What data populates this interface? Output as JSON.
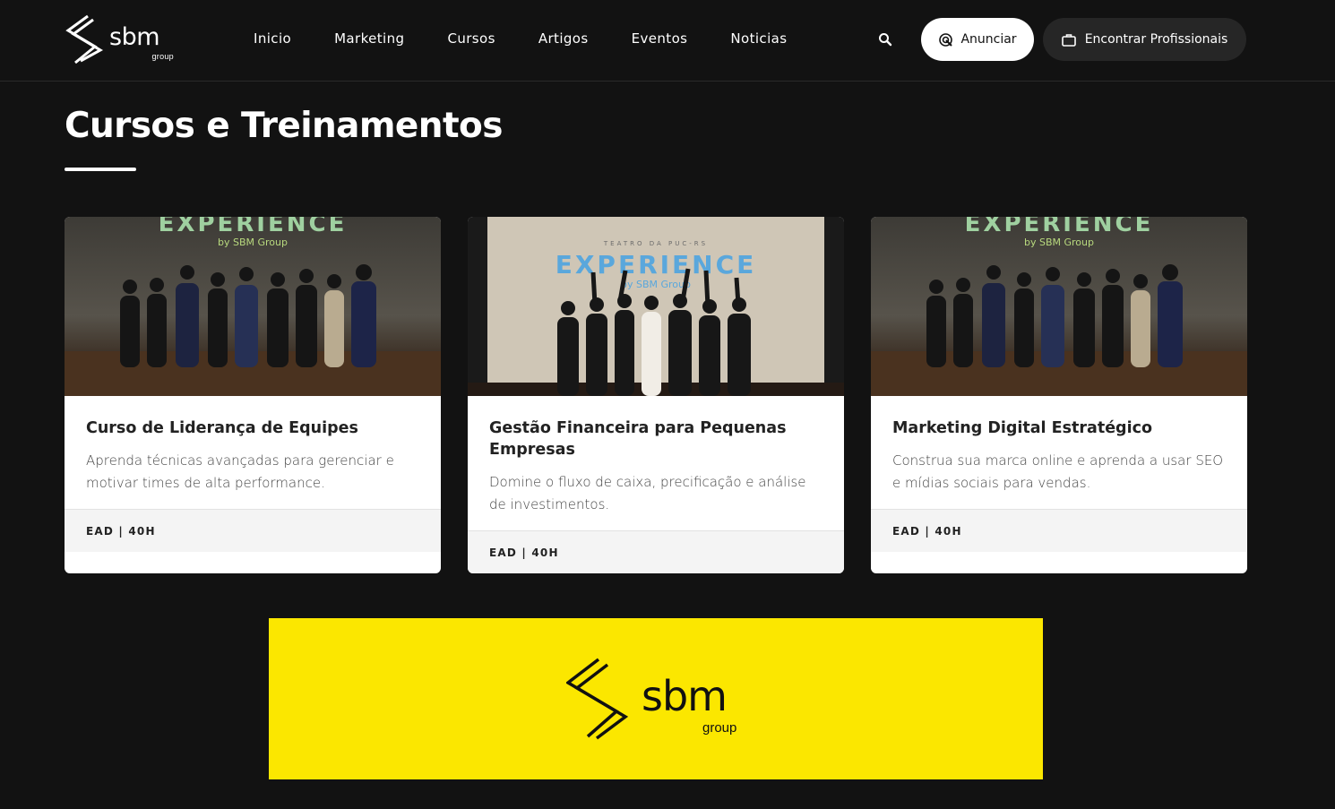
{
  "header": {
    "logo_word": "sbm",
    "logo_sub": "group",
    "nav": [
      "Inicio",
      "Marketing",
      "Cursos",
      "Artigos",
      "Eventos",
      "Noticias"
    ],
    "search_icon": "search-icon",
    "anunciar_label": "Anunciar",
    "encontrar_label": "Encontrar Profissionais"
  },
  "page": {
    "title": "Cursos e Treinamentos"
  },
  "cards": [
    {
      "image_text_main": "EXPERIENCE",
      "image_text_sub": "by SBM Group",
      "title": "Curso de Liderança de Equipes",
      "description": "Aprenda técnicas avançadas para gerenciar e motivar times de alta performance.",
      "meta": "EAD | 40H"
    },
    {
      "image_text_top": "TEATRO DA PUC-RS",
      "image_text_main": "EXPERIENCE",
      "image_text_sub": "by SBM Group",
      "title": "Gestão Financeira para Pequenas Empresas",
      "description": "Domine o fluxo de caixa, precificação e análise de investimentos.",
      "meta": "EAD | 40H"
    },
    {
      "image_text_main": "EXPERIENCE",
      "image_text_sub": "by SBM Group",
      "title": "Marketing Digital Estratégico",
      "description": "Construa sua marca online e aprenda a usar SEO e mídias sociais para vendas.",
      "meta": "EAD | 40H"
    }
  ],
  "banner": {
    "logo_word": "sbm",
    "logo_sub": "group",
    "background": "#fbe700"
  },
  "colors": {
    "page_bg": "#121212",
    "card_bg": "#ffffff",
    "footer_bg": "#f4f4f4",
    "accent_yellow": "#fbe700"
  }
}
